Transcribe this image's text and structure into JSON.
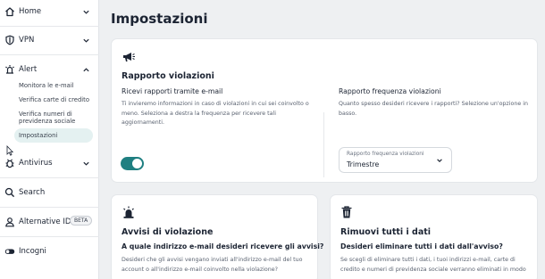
{
  "sidebar": {
    "home": "Home",
    "vpn": "VPN",
    "alert": "Alert",
    "alert_items": [
      "Monitora le e-mail",
      "Verifica carte di credito",
      "Verifica numeri di",
      "previdenza sociale",
      "Impostazioni"
    ],
    "antivirus": "Antivirus",
    "search": "Search",
    "alternative_id": "Alternative ID",
    "beta_badge": "BETA",
    "incogni": "Incogni"
  },
  "main": {
    "title": "Impostazioni",
    "report": {
      "section_title": "Rapporto violazioni",
      "email_title": "Ricevi rapporti tramite e-mail",
      "email_desc": "Ti invieremo informazioni in caso di violazioni in cui sei coinvolto o meno. Seleziona a destra la frequenza per ricevere tali aggiornamenti.",
      "freq_title": "Rapporto frequenza violazioni",
      "freq_desc": "Quanto spesso desideri ricevere i rapporti? Selezione un'opzione in basso.",
      "select_label": "Rapporto frequenza violazioni",
      "select_value": "Trimestre",
      "toggle_on": true
    },
    "alerts_card": {
      "title": "Avvisi di violazione",
      "question": "A quale indirizzo e-mail desideri ricevere gli avvisi?",
      "desc": "Desideri che gli avvisi vengano inviati all'indirizzo e-mail del tuo account o all'indirizzo e-mail coinvolto nella violazione?"
    },
    "delete_card": {
      "title": "Rimuovi tutti i dati",
      "question": "Desideri eliminare tutti i dati dall'avviso?",
      "desc": "Se scegli di eliminare tutti i dati, i tuoi indirizzi e-mail, carte di credito e numeri di previdenza sociale verranno eliminati in modo"
    }
  },
  "colors": {
    "accent": "#1f7f81",
    "active_bg": "#e4f1f1",
    "page_bg": "#eef0f2"
  }
}
